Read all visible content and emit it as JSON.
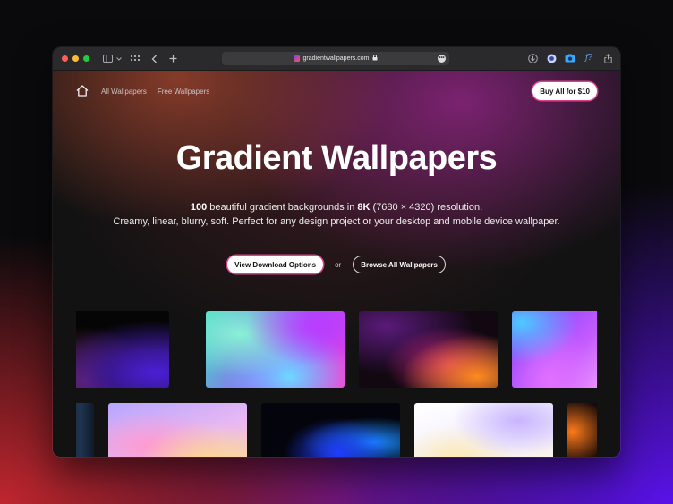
{
  "browser": {
    "url": "gradientwallpapers.com",
    "icons": [
      "sidebar-icon",
      "chevron-down-icon",
      "tab-grid-icon",
      "back-icon",
      "new-tab-icon",
      "lock-icon",
      "more-icon",
      "download-icon",
      "extension-icon",
      "camera-icon",
      "formula-icon",
      "share-icon"
    ],
    "traffic_colors": {
      "close": "#ff5f57",
      "minimize": "#febc2e",
      "maximize": "#28c840"
    }
  },
  "nav": {
    "home_icon": "home-icon",
    "links": [
      "All Wallpapers",
      "Free Wallpapers"
    ],
    "buy_label": "Buy All for $10"
  },
  "hero": {
    "title": "Gradient Wallpapers",
    "line1": {
      "count": "100",
      "mid": " beautiful gradient backgrounds in ",
      "res": "8K",
      "tail": " (7680 × 4320) resolution."
    },
    "line2": "Creamy, linear, blurry, soft. Perfect for any design project or your desktop and mobile device wallpaper."
  },
  "cta": {
    "primary": "View Download Options",
    "or": "or",
    "secondary": "Browse All Wallpapers"
  },
  "accent_color": "#e0408a",
  "gallery": {
    "tile_count": 9
  }
}
